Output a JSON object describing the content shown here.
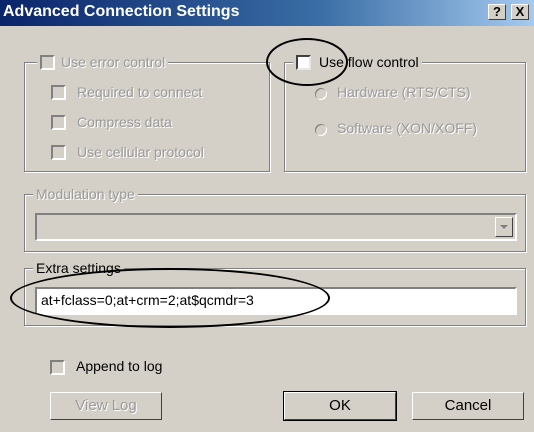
{
  "window": {
    "title": "Advanced Connection Settings",
    "help_label": "?",
    "close_label": "X"
  },
  "error_control": {
    "label": "Use error control",
    "label_accel": "e",
    "items": [
      {
        "label": "Required to connect",
        "accel": "R"
      },
      {
        "label": "Compress data",
        "accel": "C"
      },
      {
        "label": "Use cellular protocol",
        "accel": "U"
      }
    ]
  },
  "flow_control": {
    "label": "Use flow control",
    "accel": "f",
    "options": [
      {
        "label": "Hardware (RTS/CTS)",
        "accel": "H"
      },
      {
        "label": "Software (XON/XOFF)",
        "accel": "S"
      }
    ]
  },
  "modulation": {
    "label": "Modulation type",
    "value": "",
    "dropdown_icon": "chevron-down-icon"
  },
  "extra": {
    "label": "Extra settings",
    "value": "at+fclass=0;at+crm=2;at$qcmdr=3"
  },
  "append": {
    "label": "Append to log",
    "accel": "A"
  },
  "buttons": {
    "view_log": "View Log",
    "ok": "OK",
    "cancel": "Cancel"
  },
  "colors": {
    "title_start": "#0a246a",
    "title_end": "#a6caf0",
    "face": "#d4d0c8",
    "annotation": "#000000"
  }
}
